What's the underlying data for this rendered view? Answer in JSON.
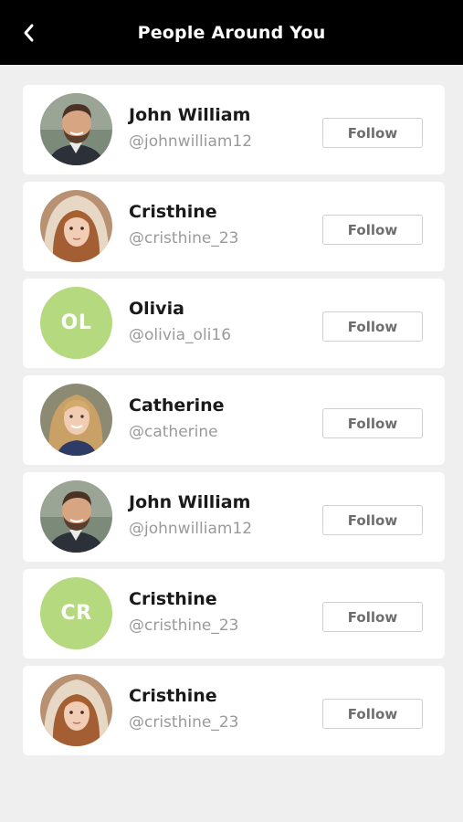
{
  "header": {
    "title": "People Around You",
    "back_icon": "chevron-left-icon"
  },
  "colors": {
    "header_bg": "#000000",
    "page_bg": "#efefef",
    "initials_bg": "#b5d97e",
    "handle_text": "#9a9a9a"
  },
  "people": [
    {
      "name": "John William",
      "handle": "@johnwilliam12",
      "avatar": "photo-man-beard",
      "initials": "",
      "follow_label": "Follow"
    },
    {
      "name": "Cristhine",
      "handle": "@cristhine_23",
      "avatar": "photo-woman-hood",
      "initials": "",
      "follow_label": "Follow"
    },
    {
      "name": "Olivia",
      "handle": "@olivia_oli16",
      "avatar": "initials",
      "initials": "OL",
      "follow_label": "Follow"
    },
    {
      "name": "Catherine",
      "handle": "@catherine",
      "avatar": "photo-woman-blonde",
      "initials": "",
      "follow_label": "Follow"
    },
    {
      "name": "John William",
      "handle": "@johnwilliam12",
      "avatar": "photo-man-beard",
      "initials": "",
      "follow_label": "Follow"
    },
    {
      "name": "Cristhine",
      "handle": "@cristhine_23",
      "avatar": "initials",
      "initials": "CR",
      "follow_label": "Follow"
    },
    {
      "name": "Cristhine",
      "handle": "@cristhine_23",
      "avatar": "photo-woman-hood",
      "initials": "",
      "follow_label": "Follow"
    }
  ]
}
